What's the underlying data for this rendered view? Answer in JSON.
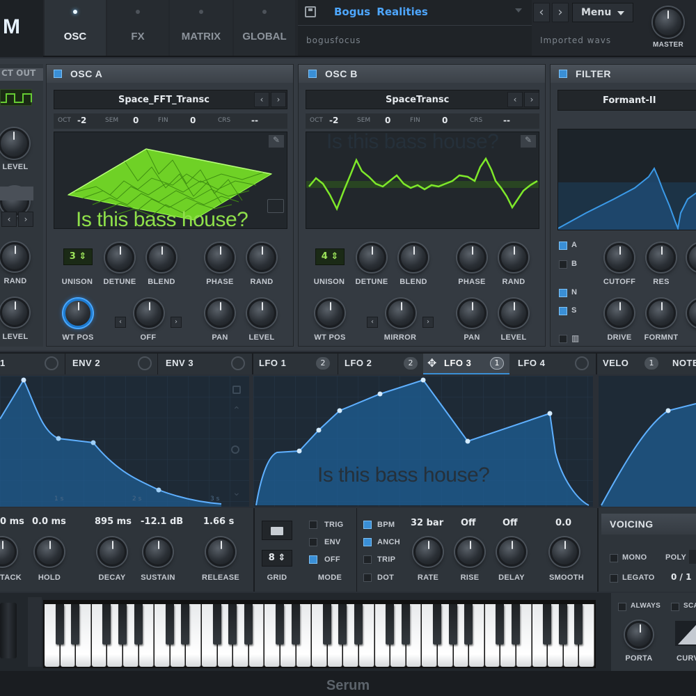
{
  "app": {
    "logo_partial": "M",
    "footer": "Serum"
  },
  "top_tabs": [
    {
      "label": "OSC"
    },
    {
      "label": "FX"
    },
    {
      "label": "MATRIX"
    },
    {
      "label": "GLOBAL"
    }
  ],
  "preset": {
    "name": "Bogus Realities",
    "author": "bogusfocus",
    "bank": "Imported wavs",
    "menu": "Menu",
    "prev": "‹",
    "next": "›"
  },
  "master": {
    "label": "MASTER"
  },
  "left_strip": {
    "direct_out": "CT OUT",
    "level": "LEVEL",
    "rand": "RAND",
    "level2": "LEVEL"
  },
  "osc_a": {
    "title": "OSC A",
    "wavetable": "Space_FFT_Transc",
    "oct_label": "OCT",
    "oct": "-2",
    "sem_label": "SEM",
    "sem": "0",
    "fin_label": "FIN",
    "fin": "0",
    "crs_label": "CRS",
    "crs": "--",
    "unison_value": "3",
    "knobs": {
      "unison": "UNISON",
      "detune": "DETUNE",
      "blend": "BLEND",
      "phase": "PHASE",
      "rand": "RAND",
      "wtpos": "WT POS",
      "off": "OFF",
      "pan": "PAN",
      "level": "LEVEL"
    }
  },
  "osc_b": {
    "title": "OSC B",
    "wavetable": "SpaceTransc",
    "oct_label": "OCT",
    "oct": "-2",
    "sem_label": "SEM",
    "sem": "0",
    "fin_label": "FIN",
    "fin": "0",
    "crs_label": "CRS",
    "crs": "--",
    "unison_value": "4",
    "knobs": {
      "unison": "UNISON",
      "detune": "DETUNE",
      "blend": "BLEND",
      "phase": "PHASE",
      "rand": "RAND",
      "wtpos": "WT POS",
      "mirror": "MIRROR",
      "pan": "PAN",
      "level": "LEVEL"
    }
  },
  "filter": {
    "title": "FILTER",
    "type": "Formant-II",
    "routes": {
      "a": "A",
      "b": "B",
      "n": "N",
      "s": "S"
    },
    "knobs": {
      "cutoff": "CUTOFF",
      "res": "RES",
      "drive": "DRIVE",
      "formnt": "FORMNT"
    }
  },
  "mod_tabs": {
    "env1": "1",
    "env2": "ENV 2",
    "env3": "ENV 3",
    "lfo1": "LFO 1",
    "lfo1_count": "2",
    "lfo2": "LFO 2",
    "lfo2_count": "2",
    "lfo3": "LFO 3",
    "lfo3_count": "1",
    "lfo4": "LFO 4",
    "velo": "VELO",
    "velo_count": "1",
    "note": "NOTE"
  },
  "env": {
    "values": {
      "attack": "0 ms",
      "hold": "0.0 ms",
      "decay": "895 ms",
      "sustain": "-12.1 dB",
      "release": "1.66 s"
    },
    "labels": {
      "attack": "TACK",
      "hold": "HOLD",
      "decay": "DECAY",
      "sustain": "SUSTAIN",
      "release": "RELEASE"
    },
    "ruler": [
      "1 s",
      "2 s",
      "3 s"
    ]
  },
  "lfo": {
    "grid_value": "8",
    "grid_label": "GRID",
    "mode_label": "MODE",
    "modes": [
      "TRIG",
      "ENV",
      "OFF"
    ],
    "opts": [
      "BPM",
      "ANCH",
      "TRIP",
      "DOT"
    ],
    "rate_value": "32 bar",
    "rise_value": "Off",
    "delay_value": "Off",
    "smooth_value": "0.0",
    "labels": {
      "rate": "RATE",
      "rise": "RISE",
      "delay": "DELAY",
      "smooth": "SMOOTH"
    }
  },
  "voicing": {
    "title": "VOICING",
    "mono": "MONO",
    "poly": "POLY",
    "legato": "LEGATO",
    "legato_value": "0 / 1"
  },
  "porta": {
    "always": "ALWAYS",
    "scaled": "SCA",
    "porta": "PORTA",
    "curve": "CURV"
  },
  "overlay_text": "Is this bass house?",
  "colors": {
    "accent": "#3a8fd6",
    "wavetable_green": "#7ee82a",
    "env_blue": "#1e5f96",
    "overlay_green": "#8fe04a",
    "overlay_dark": "#25303a"
  }
}
